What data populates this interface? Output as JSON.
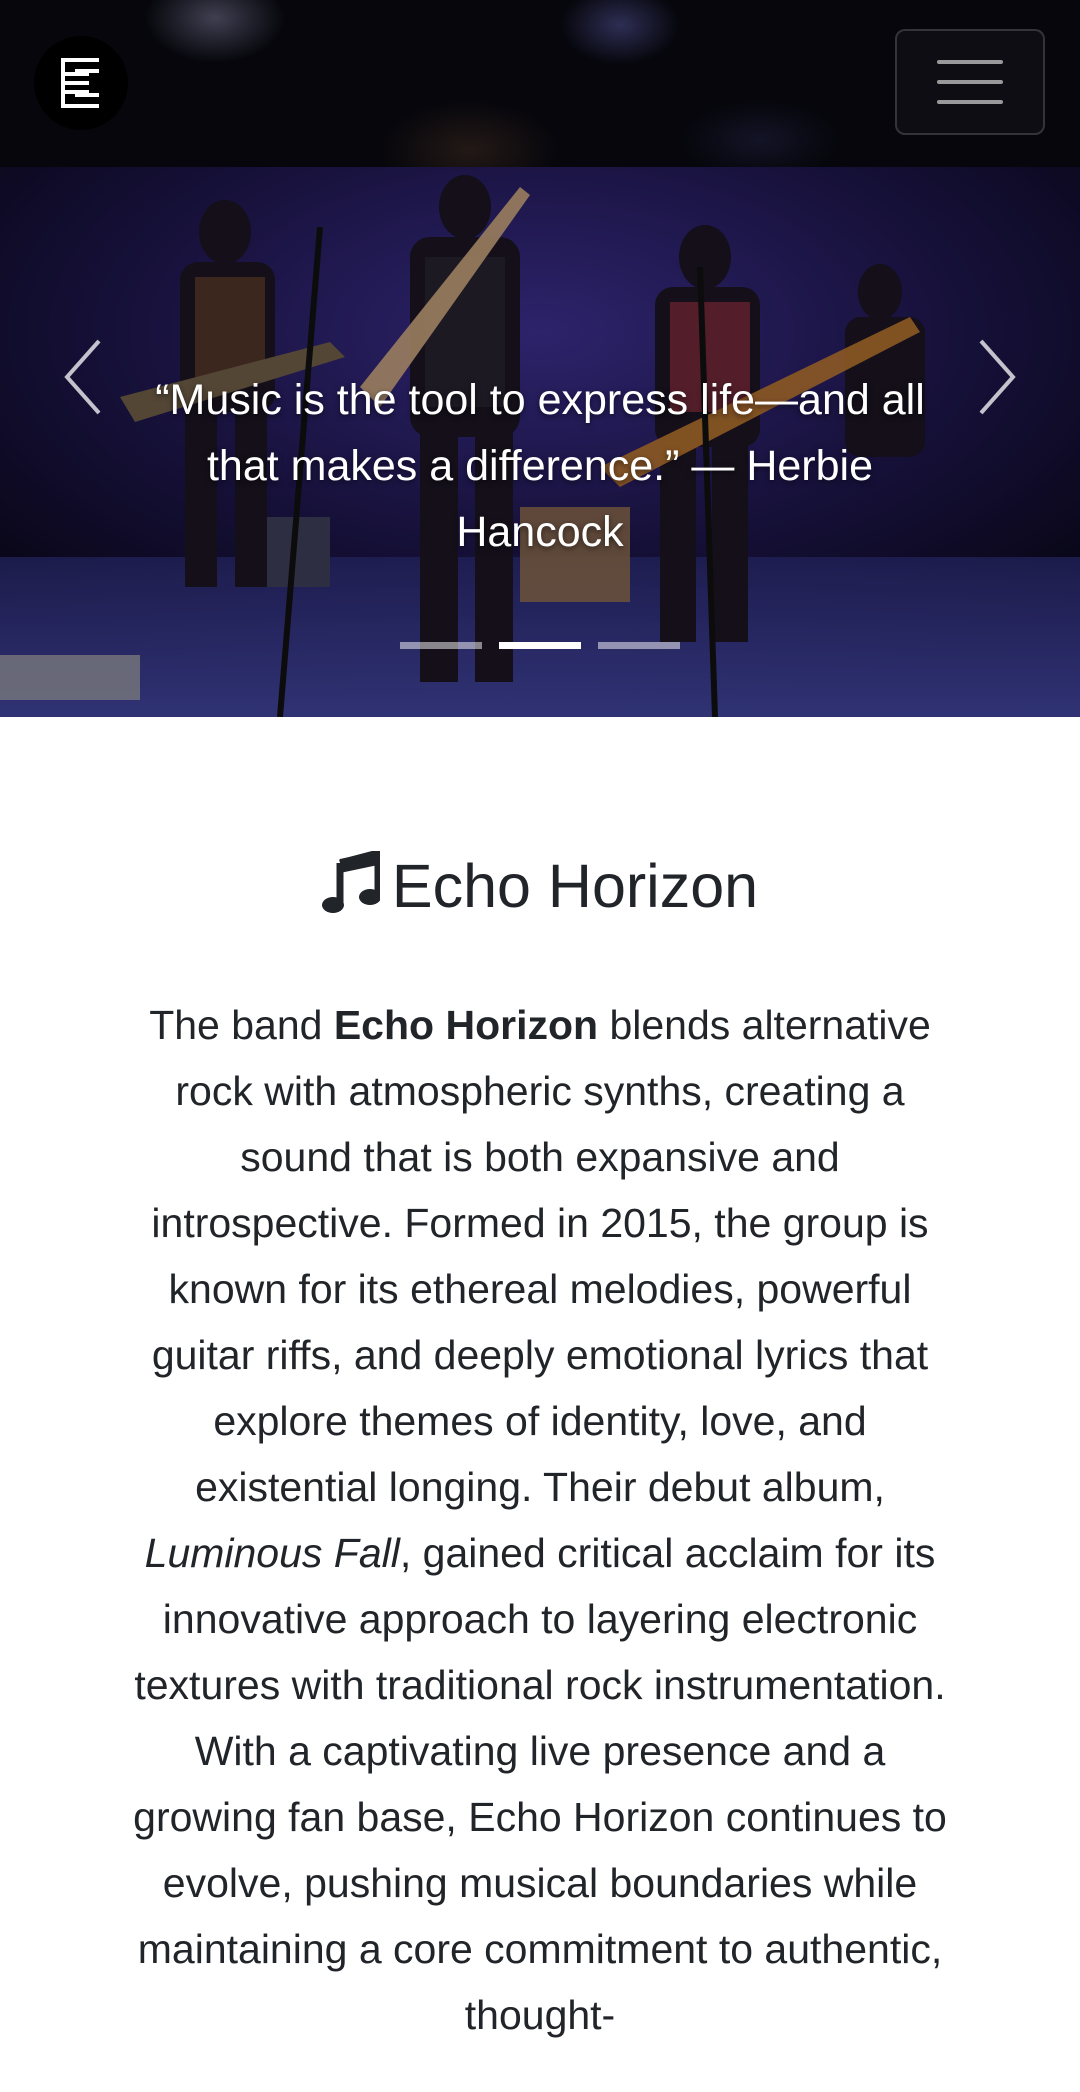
{
  "navbar": {
    "logo_icon": "band-logo-icon",
    "menu_icon": "hamburger-menu-icon"
  },
  "carousel": {
    "quote": "“Music is the tool to express life—and all that makes a difference.” — Herbie Hancock",
    "prev_icon": "chevron-left-icon",
    "next_icon": "chevron-right-icon",
    "slides_count": 3,
    "active_slide": 2
  },
  "about": {
    "title": "Echo Horizon",
    "title_icon": "music-note-icon",
    "text_intro": "The band ",
    "band_name": "Echo Horizon",
    "text_part1": " blends alternative rock with atmospheric synths, creating a sound that is both expansive and introspective. Formed in 2015, the group is known for its ethereal melodies, powerful guitar riffs, and deeply emotional lyrics that explore themes of identity, love, and existential longing. Their debut album, ",
    "album_name": "Luminous Fall",
    "text_part2": ", gained critical acclaim for its innovative approach to layering electronic textures with traditional rock instrumentation. With a captivating live presence and a growing fan base, Echo Horizon continues to evolve, pushing musical boundaries while maintaining a core commitment to authentic, thought-"
  },
  "colors": {
    "navbar_bg": "#06060c",
    "text": "#212529",
    "page_bg": "#ffffff",
    "stage_light": "#5a3fd0"
  }
}
